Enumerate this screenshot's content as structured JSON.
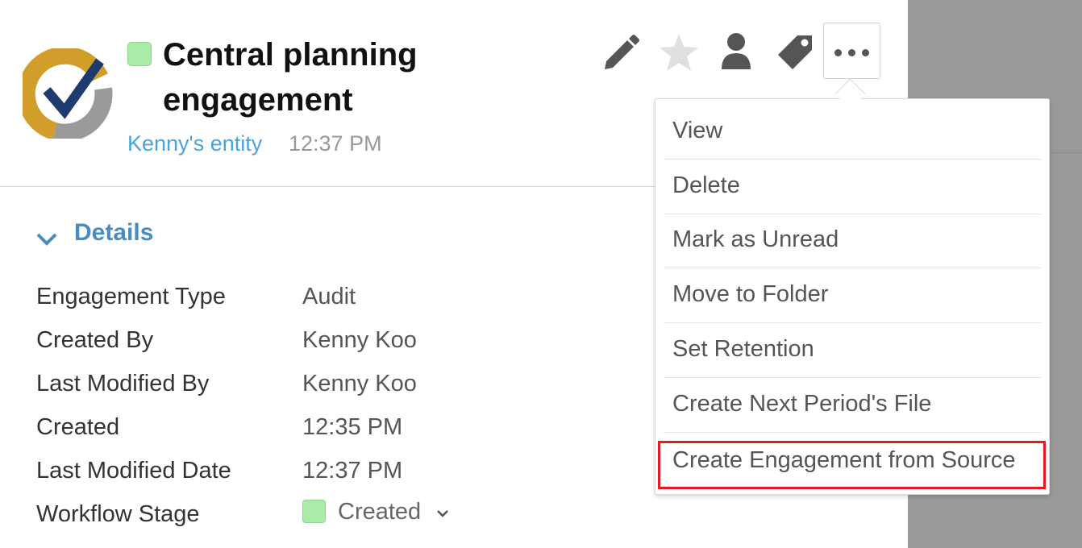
{
  "header": {
    "title_line1": "Central planning",
    "title_line2": "engagement",
    "entity": "Kenny's entity",
    "time": "12:37 PM",
    "status_color": "#a8eca8"
  },
  "toolbar": {
    "icons": [
      "pencil-icon",
      "star-icon",
      "user-icon",
      "tag-icon",
      "more-icon"
    ]
  },
  "details": {
    "label": "Details",
    "properties": [
      {
        "label": "Engagement Type",
        "value": "Audit"
      },
      {
        "label": "Created By",
        "value": "Kenny Koo"
      },
      {
        "label": "Last Modified By",
        "value": "Kenny Koo"
      },
      {
        "label": "Created",
        "value": "12:35 PM"
      },
      {
        "label": "Last Modified Date",
        "value": "12:37 PM"
      },
      {
        "label": "Workflow Stage",
        "value": "Created"
      }
    ]
  },
  "menu": {
    "items": [
      {
        "label": "View"
      },
      {
        "label": "Delete"
      },
      {
        "label": "Mark as Unread"
      },
      {
        "label": "Move to Folder"
      },
      {
        "label": "Set Retention"
      },
      {
        "label": "Create Next Period's File"
      },
      {
        "label": "Create Engagement from Source"
      }
    ],
    "highlight_color": "#e31b23"
  },
  "colors": {
    "link": "#4ba3dc",
    "details_heading": "#4a8cc0",
    "logo_gold": "#d19e2b",
    "logo_gray": "#9a9a9a",
    "logo_navy": "#1f3a6e"
  }
}
